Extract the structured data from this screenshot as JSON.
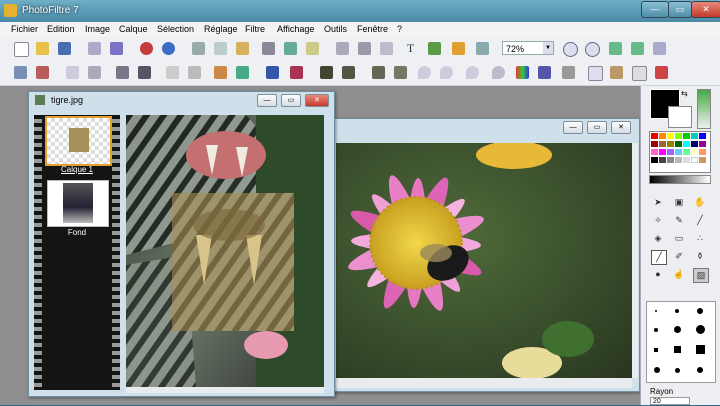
{
  "app": {
    "title": "PhotoFiltre 7"
  },
  "window_controls": {
    "minimize": "—",
    "maximize": "▭",
    "close": "✕"
  },
  "menu": [
    "Fichier",
    "Edition",
    "Image",
    "Calque",
    "Sélection",
    "Réglage",
    "Filtre",
    "Affichage",
    "Outils",
    "Fenêtre",
    "?"
  ],
  "toolbar": {
    "zoom_value": "72%",
    "zoom_dropdown": "▼"
  },
  "doc_tiger": {
    "title": "tigre.jpg",
    "min": "—",
    "max": "▭",
    "close": "✕"
  },
  "layers": [
    {
      "name": "Calque 1"
    },
    {
      "name": "Fond"
    }
  ],
  "doc_flower": {
    "min": "—",
    "max": "▭",
    "close": "✕"
  },
  "tools_panel": {
    "rayon_label": "Rayon",
    "rayon_value": "20"
  },
  "colors": {
    "titlebar": "#4a8aa6",
    "workspace": "#8e8e8e",
    "foreground": "#000000",
    "background": "#ffffff",
    "close_button": "#c5392a"
  },
  "icons": [
    "new-icon",
    "open-icon",
    "save-icon",
    "print-icon",
    "undo-icon",
    "redo-icon",
    "copy-icon",
    "paste-icon",
    "text-icon",
    "zoom-in-icon",
    "zoom-out-icon",
    "fullscreen-icon",
    "pointer-icon",
    "selection-icon",
    "hand-icon",
    "magic-wand-icon",
    "eyedropper-icon",
    "line-icon",
    "fill-icon",
    "eraser-icon",
    "brush-icon",
    "pencil-icon",
    "clone-icon",
    "blur-icon",
    "smudge-icon",
    "stamp-icon"
  ]
}
